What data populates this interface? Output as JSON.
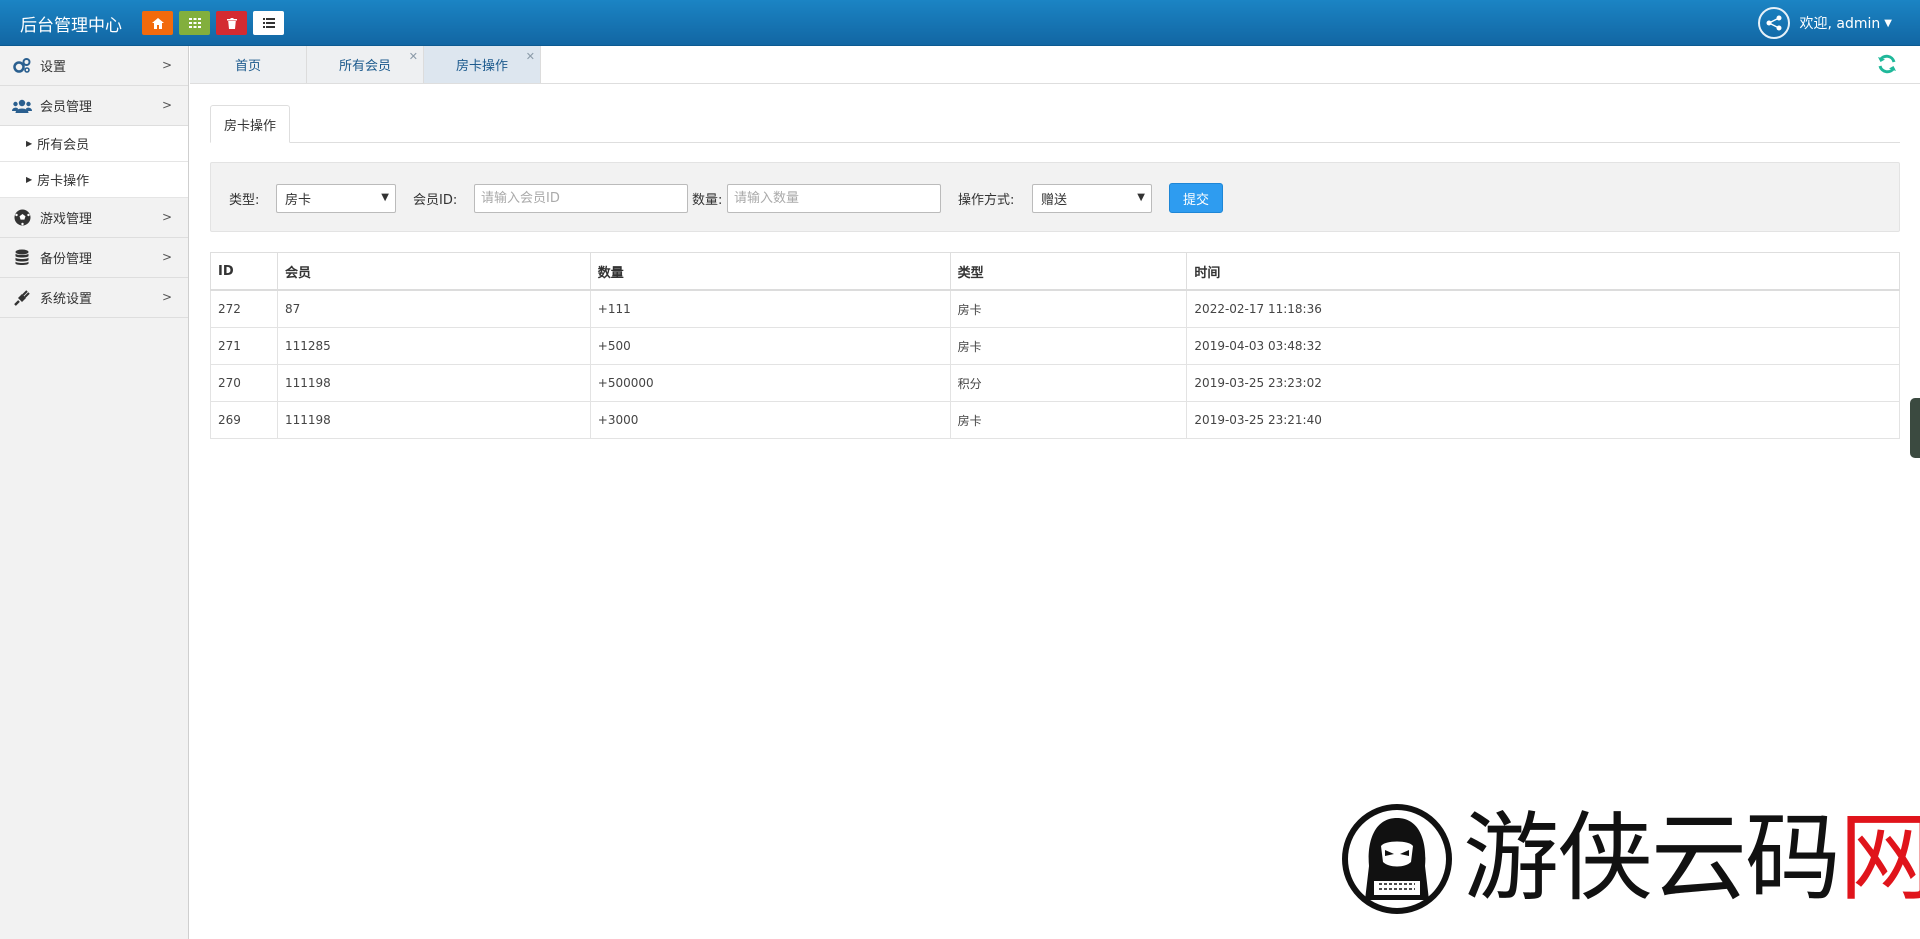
{
  "header": {
    "brand": "后台管理中心",
    "shortcuts": [
      "home-icon",
      "grid-icon",
      "trash-icon",
      "list-icon"
    ],
    "shortcut_colors": [
      "#f26a0c",
      "#82af3d",
      "#d42b31",
      "#ffffff"
    ],
    "user_greeting": "欢迎, admin"
  },
  "sidebar": {
    "items": [
      {
        "label": "设置",
        "icon": "gears-icon"
      },
      {
        "label": "会员管理",
        "icon": "users-icon"
      },
      {
        "label": "游戏管理",
        "icon": "soccer-ball-icon"
      },
      {
        "label": "备份管理",
        "icon": "database-icon"
      },
      {
        "label": "系统设置",
        "icon": "plug-icon"
      }
    ],
    "subitems": [
      {
        "label": "所有会员"
      },
      {
        "label": "房卡操作"
      }
    ]
  },
  "tabs": [
    {
      "label": "首页",
      "closable": false
    },
    {
      "label": "所有会员",
      "closable": true
    },
    {
      "label": "房卡操作",
      "closable": true,
      "active": true
    }
  ],
  "page": {
    "inner_tab": "房卡操作",
    "form": {
      "type_label": "类型:",
      "type_value": "房卡",
      "member_label": "会员ID:",
      "member_placeholder": "请输入会员ID",
      "qty_label": "数量:",
      "qty_placeholder": "请输入数量",
      "method_label": "操作方式:",
      "method_value": "赠送",
      "submit": "提交"
    },
    "table": {
      "headers": [
        "ID",
        "会员",
        "数量",
        "类型",
        "时间"
      ],
      "rows": [
        [
          "272",
          "87",
          "+111",
          "房卡",
          "2022-02-17 11:18:36"
        ],
        [
          "271",
          "111285",
          "+500",
          "房卡",
          "2019-04-03 03:48:32"
        ],
        [
          "270",
          "111198",
          "+500000",
          "积分",
          "2019-03-25 23:23:02"
        ],
        [
          "269",
          "111198",
          "+3000",
          "房卡",
          "2019-03-25 23:21:40"
        ]
      ]
    }
  },
  "watermark": {
    "text": "游侠云码",
    "mark": "网"
  },
  "colors": {
    "navbar": "#1672b3",
    "tab_text": "#1c5a8d",
    "submit": "#2e9cf0",
    "refresh": "#1fb89a",
    "watermark_red": "#e0141b"
  }
}
